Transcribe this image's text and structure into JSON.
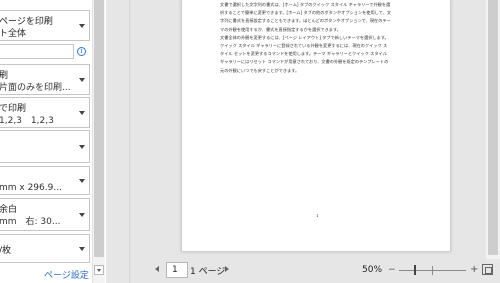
{
  "settings": {
    "print_range": {
      "title": "ページを印刷",
      "value": "ト全体"
    },
    "pages_placeholder": "",
    "sides": {
      "title": "刷",
      "value": "片面のみを印刷..."
    },
    "collation": {
      "title": "で印刷",
      "value": "1,2,3　1,2,3"
    },
    "orientation": {
      "title": "",
      "value": ""
    },
    "paper_size": {
      "title": "",
      "value": "mm x 296.9..."
    },
    "margins": {
      "title": "余白",
      "value": "mm　右: 30..."
    },
    "per_sheet": {
      "title": "/枚",
      "value": ""
    },
    "page_setup_link": "ページ設定",
    "info_glyph": "i"
  },
  "preview": {
    "document_lines": [
      "文書で選択した文字列の書式は、[ホーム] タブのクイック スタイル ギャラリーで外観を選",
      "択することで簡単に変更できます。[ホーム] タブの他のボタンやオプションを使用して、文",
      "字列に書式を直接設定することもできます。ほとんどのボタンやオプションで、現在のテー",
      "マの外観を使用するか、書式を直接指定するかを選択できます。",
      "文書全体の外観を変更するには、[ページ レイアウト] タブで新しいテーマを選択します。",
      "クイック スタイル ギャラリーに登録されている外観を変更するには、現在のクイック ス",
      "タイル セットを変更するコマンドを使用します。テーマ ギャラリーとクイック スタイル",
      "ギャラリーにはリセット コマンドが用意されており、文書の外観を既定のテンプレートの",
      "元の外観にいつでも戻すことができます。"
    ],
    "page_number": "1"
  },
  "nav": {
    "current_page": "1",
    "total_pages": "1 ページ",
    "zoom": "50%",
    "zoom_out_glyph": "−",
    "zoom_in_glyph": "+",
    "zoom_level_fraction": 0.5
  }
}
